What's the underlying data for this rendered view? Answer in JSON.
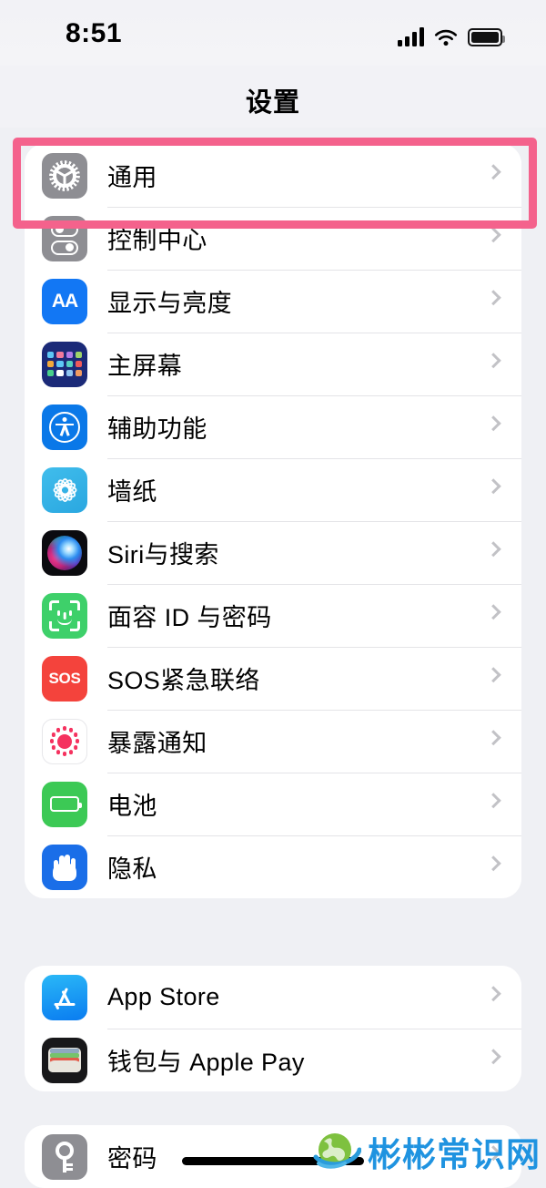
{
  "status_bar": {
    "time": "8:51",
    "icons": [
      "cellular-signal-icon",
      "wifi-icon",
      "battery-icon"
    ],
    "battery_level": "88"
  },
  "nav": {
    "title": "设置"
  },
  "highlight": {
    "color": "#f4628c",
    "target": "通用"
  },
  "groups": [
    {
      "id": "group1",
      "rows": [
        {
          "label": "通用",
          "icon": "gear-icon",
          "accessory": "chevron-right-icon"
        },
        {
          "label": "控制中心",
          "icon": "control-center-icon",
          "accessory": "chevron-right-icon"
        },
        {
          "label": "显示与亮度",
          "icon": "display-brightness-aa-icon",
          "accessory": "chevron-right-icon"
        },
        {
          "label": "主屏幕",
          "icon": "home-screen-grid-icon",
          "accessory": "chevron-right-icon"
        },
        {
          "label": "辅助功能",
          "icon": "accessibility-icon",
          "accessory": "chevron-right-icon"
        },
        {
          "label": "墙纸",
          "icon": "wallpaper-flower-icon",
          "accessory": "chevron-right-icon"
        },
        {
          "label": "Siri与搜索",
          "icon": "siri-orb-icon",
          "accessory": "chevron-right-icon"
        },
        {
          "label": "面容 ID 与密码",
          "icon": "face-id-icon",
          "accessory": "chevron-right-icon"
        },
        {
          "label": "SOS紧急联络",
          "icon": "sos-icon",
          "accessory": "chevron-right-icon"
        },
        {
          "label": "暴露通知",
          "icon": "exposure-notification-icon",
          "accessory": "chevron-right-icon"
        },
        {
          "label": "电池",
          "icon": "battery-green-icon",
          "accessory": "chevron-right-icon"
        },
        {
          "label": "隐私",
          "icon": "privacy-hand-icon",
          "accessory": "chevron-right-icon"
        }
      ]
    },
    {
      "id": "group2",
      "rows": [
        {
          "label": "App Store",
          "icon": "app-store-icon",
          "accessory": "chevron-right-icon"
        },
        {
          "label": "钱包与 Apple Pay",
          "icon": "wallet-icon",
          "accessory": "chevron-right-icon"
        }
      ]
    },
    {
      "id": "group3",
      "rows": [
        {
          "label": "密码",
          "icon": "key-icon",
          "accessory": "chevron-right-icon"
        }
      ]
    }
  ],
  "watermark": {
    "text": "彬彬常识网",
    "logo": "globe-icon",
    "text_color": "#1f93e0"
  },
  "colors": {
    "page_background": "#eff0f4",
    "card_background": "#ffffff",
    "separator": "#e4e4e7",
    "highlight_pink": "#f4628c",
    "chevron_gray": "#c2c2c6"
  }
}
